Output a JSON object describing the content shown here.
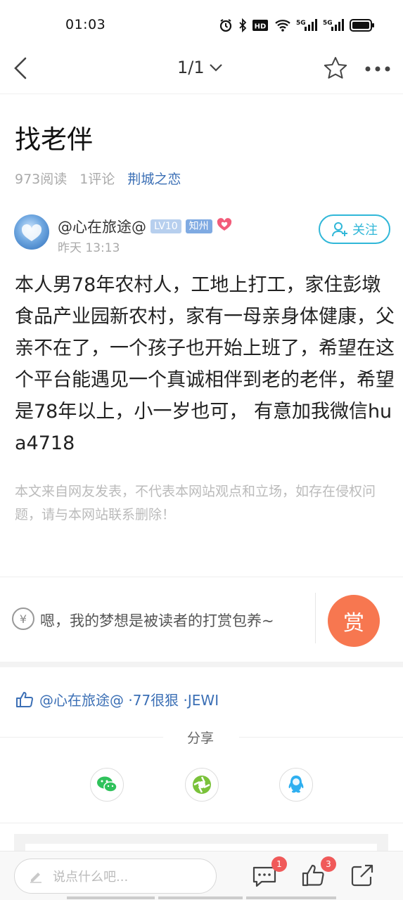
{
  "status": {
    "time": "01:03",
    "hd_label": "HD",
    "net1": "5G",
    "net2": "5G"
  },
  "nav": {
    "page_indicator": "1/1"
  },
  "post": {
    "title": "找老伴",
    "reads": "973阅读",
    "comments": "1评论",
    "forum": "荆城之恋"
  },
  "author": {
    "name": "@心在旅途@",
    "level": "LV10",
    "location": "知州",
    "time": "昨天 13:13",
    "follow_label": "关注"
  },
  "content": {
    "body": "本人男78年农村人，工地上打工，家住彭墩食品产业园新农村，家有一母亲身体健康，父亲不在了，一个孩子也开始上班了，希望在这个平台能遇见一个真诚相伴到老的老伴，希望是78年以上，小一岁也可， 有意加我微信hua4718",
    "disclaimer": "本文来自网友发表，不代表本网站观点和立场，如存在侵权问题，请与本网站联系删除！"
  },
  "reward": {
    "yen": "¥",
    "text": "嗯，我的梦想是被读者的打赏包养~",
    "button": "赏"
  },
  "likes": {
    "text": "@心在旅途@ ·77很狠 ·JEWI"
  },
  "share": {
    "title": "分享",
    "items": [
      "wechat-icon",
      "moments-icon",
      "qq-icon"
    ]
  },
  "bottom": {
    "placeholder": "说点什么吧...",
    "comment_count": "1",
    "like_count": "3"
  },
  "colors": {
    "accent": "#30b7d8",
    "link": "#3b6fb5",
    "reward": "#f77750",
    "badge": "#f05a5a"
  }
}
